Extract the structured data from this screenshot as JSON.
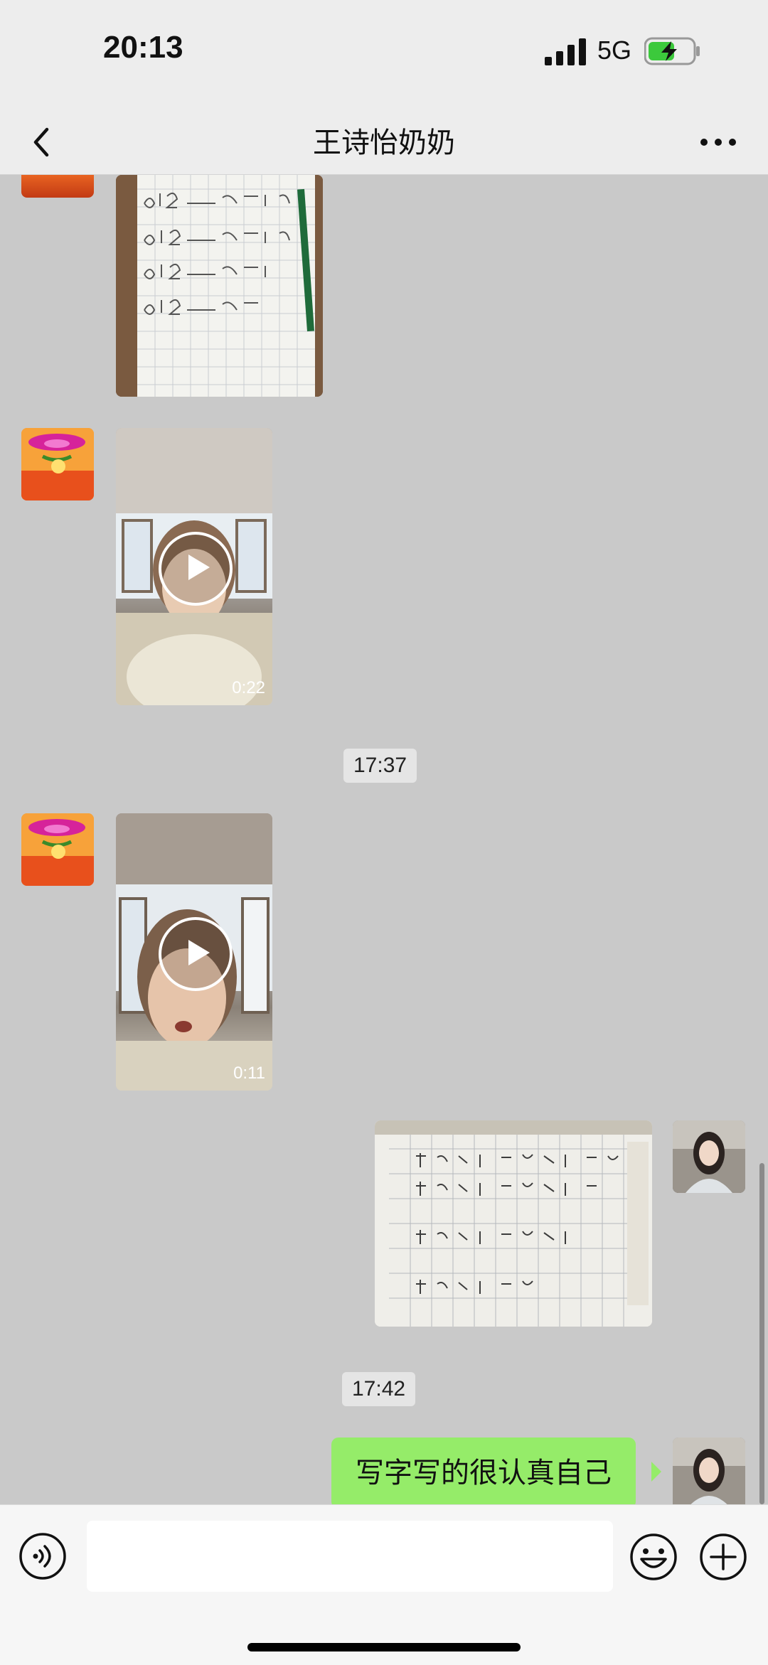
{
  "status_bar": {
    "time": "20:13",
    "network": "5G"
  },
  "nav": {
    "title": "王诗怡奶奶"
  },
  "messages": {
    "video1_duration": "0:22",
    "timestamp1": "17:37",
    "video2_duration": "0:11",
    "timestamp2": "17:42",
    "text1": "写字写的很认真自己"
  },
  "input": {
    "placeholder": ""
  },
  "colors": {
    "bubble_sent": "#95ec69",
    "chat_bg": "#c9c9c9",
    "bar_bg": "#ededed"
  }
}
